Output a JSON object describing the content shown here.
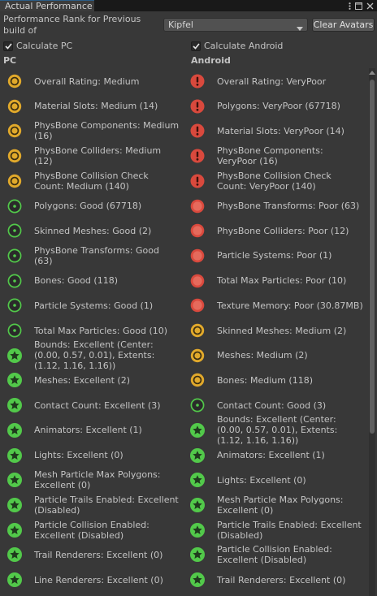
{
  "window": {
    "tab_title": "Actual Performance"
  },
  "header": {
    "rank_label": "Performance Rank for Previous build of",
    "selected_avatar": "Kipfel",
    "clear_button": "Clear Avatars"
  },
  "options": {
    "calculate_pc": "Calculate PC",
    "calculate_android": "Calculate Android",
    "calculate_pc_checked": true,
    "calculate_android_checked": true
  },
  "columns": {
    "pc": "PC",
    "android": "Android"
  },
  "colors": {
    "excellent": "#52c94a",
    "good": "#52c94a",
    "medium": "#e1a92b",
    "poor": "#d9493d",
    "verypoor": "#d9493d"
  },
  "pc": [
    {
      "text": "Overall Rating: Medium",
      "rank": "medium"
    },
    {
      "text": "Material Slots: Medium (14)",
      "rank": "medium"
    },
    {
      "text": "PhysBone Components: Medium (16)",
      "rank": "medium"
    },
    {
      "text": "PhysBone Colliders: Medium (12)",
      "rank": "medium"
    },
    {
      "text": "PhysBone Collision Check Count: Medium (140)",
      "rank": "medium"
    },
    {
      "text": "Polygons: Good (67718)",
      "rank": "good"
    },
    {
      "text": "Skinned Meshes: Good (2)",
      "rank": "good"
    },
    {
      "text": "PhysBone Transforms: Good (63)",
      "rank": "good"
    },
    {
      "text": "Bones: Good (118)",
      "rank": "good"
    },
    {
      "text": "Particle Systems: Good (1)",
      "rank": "good"
    },
    {
      "text": "Total Max Particles: Good (10)",
      "rank": "good"
    },
    {
      "text": "Bounds: Excellent (Center: (0.00, 0.57, 0.01), Extents: (1.12, 1.16, 1.16))",
      "rank": "excellent"
    },
    {
      "text": "Meshes: Excellent (2)",
      "rank": "excellent"
    },
    {
      "text": "Contact Count: Excellent (3)",
      "rank": "excellent"
    },
    {
      "text": "Animators: Excellent (1)",
      "rank": "excellent"
    },
    {
      "text": "Lights: Excellent (0)",
      "rank": "excellent"
    },
    {
      "text": "Mesh Particle Max Polygons: Excellent (0)",
      "rank": "excellent"
    },
    {
      "text": "Particle Trails Enabled: Excellent (Disabled)",
      "rank": "excellent"
    },
    {
      "text": "Particle Collision Enabled: Excellent (Disabled)",
      "rank": "excellent"
    },
    {
      "text": "Trail Renderers: Excellent (0)",
      "rank": "excellent"
    },
    {
      "text": "Line Renderers: Excellent (0)",
      "rank": "excellent"
    }
  ],
  "android": [
    {
      "text": "Overall Rating: VeryPoor",
      "rank": "verypoor"
    },
    {
      "text": "Polygons: VeryPoor (67718)",
      "rank": "verypoor"
    },
    {
      "text": "Material Slots: VeryPoor (14)",
      "rank": "verypoor"
    },
    {
      "text": "PhysBone Components: VeryPoor (16)",
      "rank": "verypoor"
    },
    {
      "text": "PhysBone Collision Check Count: VeryPoor (140)",
      "rank": "verypoor"
    },
    {
      "text": "PhysBone Transforms: Poor (63)",
      "rank": "poor"
    },
    {
      "text": "PhysBone Colliders: Poor (12)",
      "rank": "poor"
    },
    {
      "text": "Particle Systems: Poor (1)",
      "rank": "poor"
    },
    {
      "text": "Total Max Particles: Poor (10)",
      "rank": "poor"
    },
    {
      "text": "Texture Memory: Poor (30.87MB)",
      "rank": "poor"
    },
    {
      "text": "Skinned Meshes: Medium (2)",
      "rank": "medium"
    },
    {
      "text": "Meshes: Medium (2)",
      "rank": "medium"
    },
    {
      "text": "Bones: Medium (118)",
      "rank": "medium"
    },
    {
      "text": "Contact Count: Good (3)",
      "rank": "good"
    },
    {
      "text": "Bounds: Excellent (Center: (0.00, 0.57, 0.01), Extents: (1.12, 1.16, 1.16))",
      "rank": "excellent"
    },
    {
      "text": "Animators: Excellent (1)",
      "rank": "excellent"
    },
    {
      "text": "Lights: Excellent (0)",
      "rank": "excellent"
    },
    {
      "text": "Mesh Particle Max Polygons: Excellent (0)",
      "rank": "excellent"
    },
    {
      "text": "Particle Trails Enabled: Excellent (Disabled)",
      "rank": "excellent"
    },
    {
      "text": "Particle Collision Enabled: Excellent (Disabled)",
      "rank": "excellent"
    },
    {
      "text": "Trail Renderers: Excellent (0)",
      "rank": "excellent"
    }
  ]
}
